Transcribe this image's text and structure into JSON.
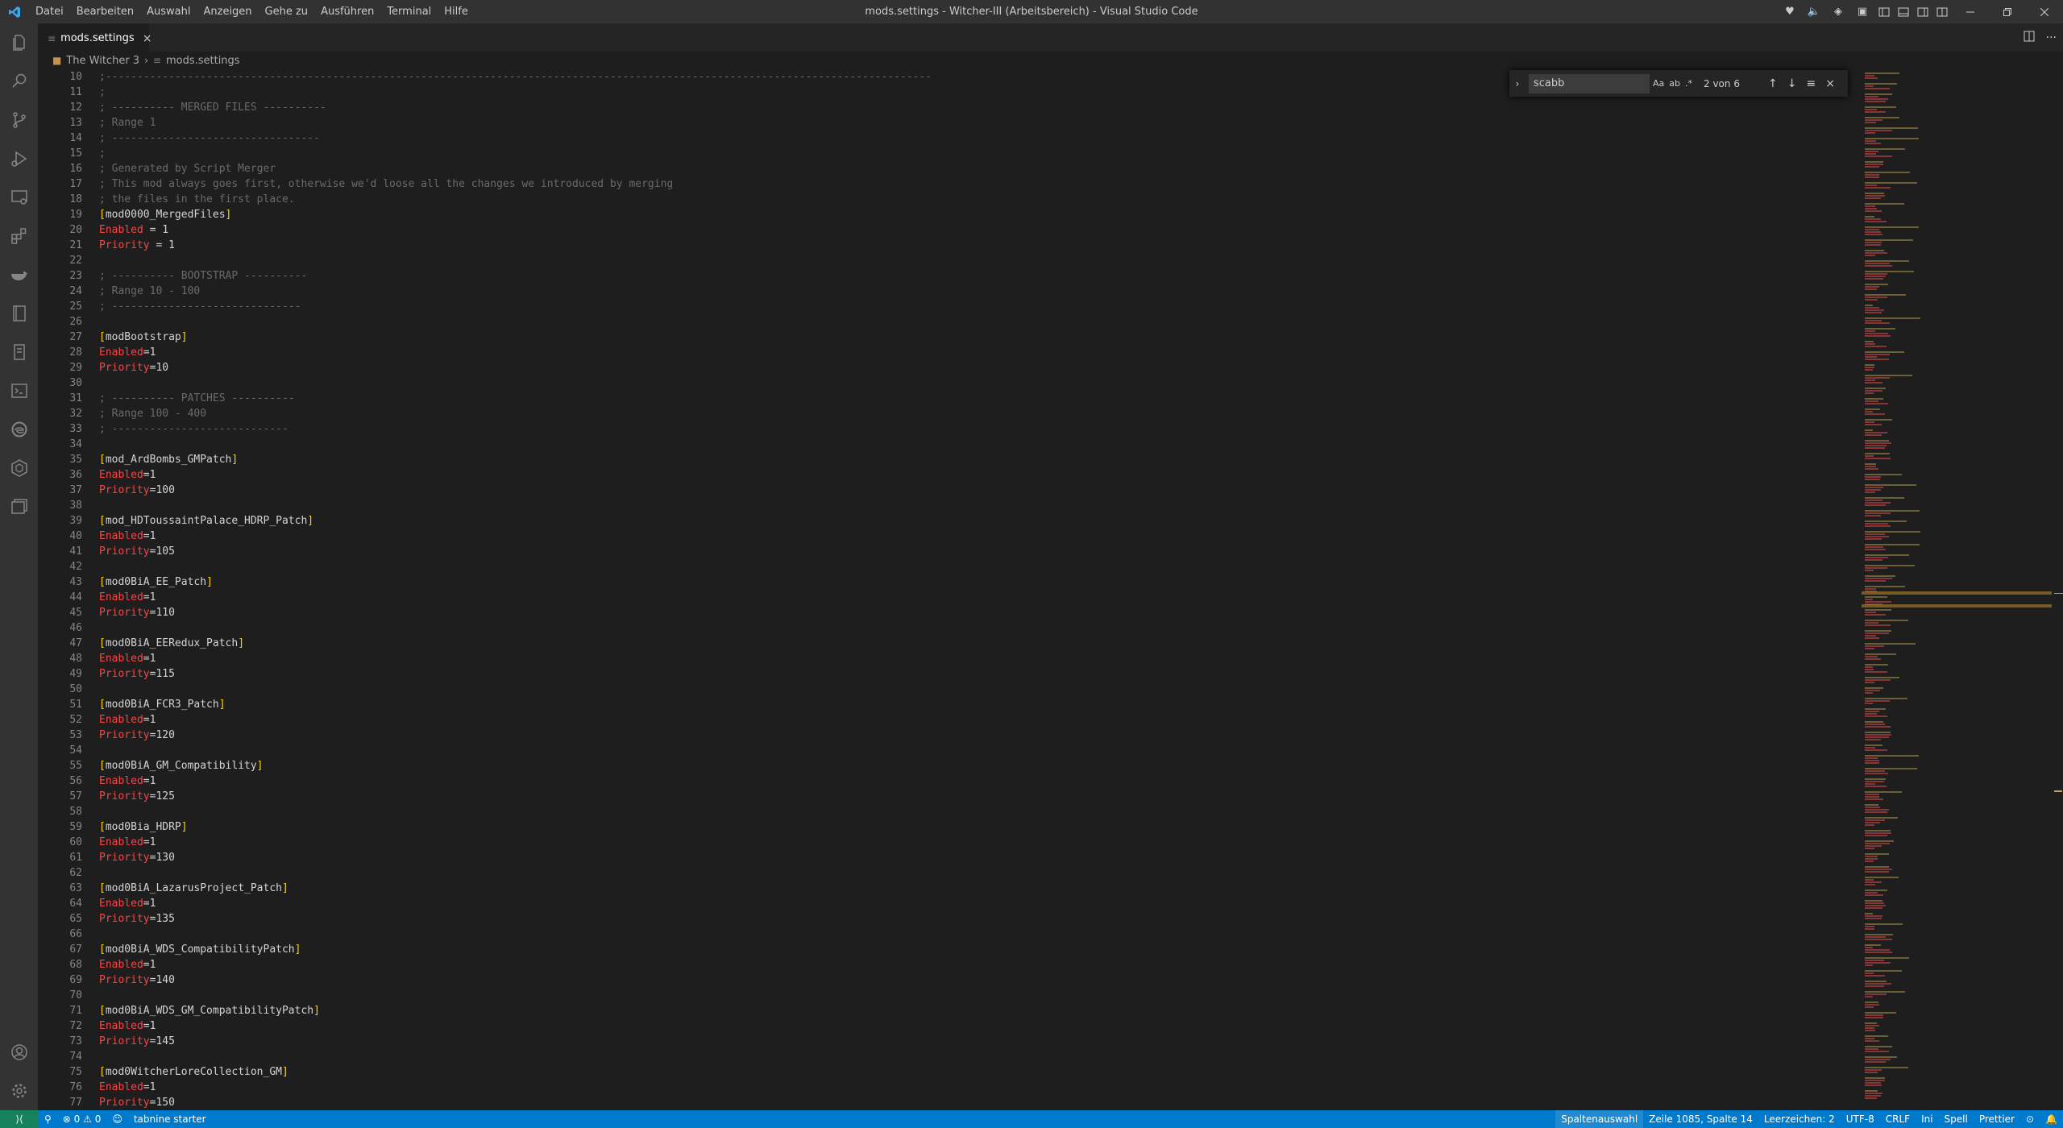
{
  "titlebar": {
    "menu": [
      "Datei",
      "Bearbeiten",
      "Auswahl",
      "Anzeigen",
      "Gehe zu",
      "Ausführen",
      "Terminal",
      "Hilfe"
    ],
    "window_title": "mods.settings - Witcher-III (Arbeitsbereich) - Visual Studio Code"
  },
  "tab": {
    "label": "mods.settings",
    "close": "×"
  },
  "breadcrumb": {
    "folder": "The Witcher 3",
    "file": "mods.settings"
  },
  "find": {
    "query": "scabb",
    "count": "2 von 6",
    "opts": [
      "Aa",
      "ab",
      ".*"
    ]
  },
  "editor": {
    "lines": [
      {
        "n": "10",
        "t": "c",
        "v": ";-----------------------------------------------------------------------------------------------------------------------------------"
      },
      {
        "n": "11",
        "t": "c",
        "v": ";"
      },
      {
        "n": "12",
        "t": "c",
        "v": "; ---------- MERGED FILES ----------"
      },
      {
        "n": "13",
        "t": "c",
        "v": "; Range 1"
      },
      {
        "n": "14",
        "t": "c",
        "v": "; ---------------------------------"
      },
      {
        "n": "15",
        "t": "c",
        "v": ";"
      },
      {
        "n": "16",
        "t": "c",
        "v": "; Generated by Script Merger"
      },
      {
        "n": "17",
        "t": "c",
        "v": "; This mod always goes first, otherwise we'd loose all the changes we introduced by merging"
      },
      {
        "n": "18",
        "t": "c",
        "v": "; the files in the first place."
      },
      {
        "n": "19",
        "t": "s",
        "v": "mod0000_MergedFiles"
      },
      {
        "n": "20",
        "t": "k",
        "k": "Enabled",
        "e": " = ",
        "v": "1"
      },
      {
        "n": "21",
        "t": "k",
        "k": "Priority",
        "e": " = ",
        "v": "1"
      },
      {
        "n": "22",
        "t": "b",
        "v": ""
      },
      {
        "n": "23",
        "t": "c",
        "v": "; ---------- BOOTSTRAP ----------"
      },
      {
        "n": "24",
        "t": "c",
        "v": "; Range 10 - 100"
      },
      {
        "n": "25",
        "t": "c",
        "v": "; ------------------------------"
      },
      {
        "n": "26",
        "t": "b",
        "v": ""
      },
      {
        "n": "27",
        "t": "s",
        "v": "modBootstrap"
      },
      {
        "n": "28",
        "t": "k",
        "k": "Enabled",
        "e": "=",
        "v": "1"
      },
      {
        "n": "29",
        "t": "k",
        "k": "Priority",
        "e": "=",
        "v": "10"
      },
      {
        "n": "30",
        "t": "b",
        "v": ""
      },
      {
        "n": "31",
        "t": "c",
        "v": "; ---------- PATCHES ----------"
      },
      {
        "n": "32",
        "t": "c",
        "v": "; Range 100 - 400"
      },
      {
        "n": "33",
        "t": "c",
        "v": "; ----------------------------"
      },
      {
        "n": "34",
        "t": "b",
        "v": ""
      },
      {
        "n": "35",
        "t": "s",
        "v": "mod_ArdBombs_GMPatch"
      },
      {
        "n": "36",
        "t": "k",
        "k": "Enabled",
        "e": "=",
        "v": "1"
      },
      {
        "n": "37",
        "t": "k",
        "k": "Priority",
        "e": "=",
        "v": "100"
      },
      {
        "n": "38",
        "t": "b",
        "v": ""
      },
      {
        "n": "39",
        "t": "s",
        "v": "mod_HDToussaintPalace_HDRP_Patch"
      },
      {
        "n": "40",
        "t": "k",
        "k": "Enabled",
        "e": "=",
        "v": "1"
      },
      {
        "n": "41",
        "t": "k",
        "k": "Priority",
        "e": "=",
        "v": "105"
      },
      {
        "n": "42",
        "t": "b",
        "v": ""
      },
      {
        "n": "43",
        "t": "s",
        "v": "mod0BiA_EE_Patch"
      },
      {
        "n": "44",
        "t": "k",
        "k": "Enabled",
        "e": "=",
        "v": "1"
      },
      {
        "n": "45",
        "t": "k",
        "k": "Priority",
        "e": "=",
        "v": "110"
      },
      {
        "n": "46",
        "t": "b",
        "v": ""
      },
      {
        "n": "47",
        "t": "s",
        "v": "mod0BiA_EERedux_Patch"
      },
      {
        "n": "48",
        "t": "k",
        "k": "Enabled",
        "e": "=",
        "v": "1"
      },
      {
        "n": "49",
        "t": "k",
        "k": "Priority",
        "e": "=",
        "v": "115"
      },
      {
        "n": "50",
        "t": "b",
        "v": ""
      },
      {
        "n": "51",
        "t": "s",
        "v": "mod0BiA_FCR3_Patch"
      },
      {
        "n": "52",
        "t": "k",
        "k": "Enabled",
        "e": "=",
        "v": "1"
      },
      {
        "n": "53",
        "t": "k",
        "k": "Priority",
        "e": "=",
        "v": "120"
      },
      {
        "n": "54",
        "t": "b",
        "v": ""
      },
      {
        "n": "55",
        "t": "s",
        "v": "mod0BiA_GM_Compatibility"
      },
      {
        "n": "56",
        "t": "k",
        "k": "Enabled",
        "e": "=",
        "v": "1"
      },
      {
        "n": "57",
        "t": "k",
        "k": "Priority",
        "e": "=",
        "v": "125"
      },
      {
        "n": "58",
        "t": "b",
        "v": ""
      },
      {
        "n": "59",
        "t": "s",
        "v": "mod0Bia_HDRP"
      },
      {
        "n": "60",
        "t": "k",
        "k": "Enabled",
        "e": "=",
        "v": "1"
      },
      {
        "n": "61",
        "t": "k",
        "k": "Priority",
        "e": "=",
        "v": "130"
      },
      {
        "n": "62",
        "t": "b",
        "v": ""
      },
      {
        "n": "63",
        "t": "s",
        "v": "mod0BiA_LazarusProject_Patch"
      },
      {
        "n": "64",
        "t": "k",
        "k": "Enabled",
        "e": "=",
        "v": "1"
      },
      {
        "n": "65",
        "t": "k",
        "k": "Priority",
        "e": "=",
        "v": "135"
      },
      {
        "n": "66",
        "t": "b",
        "v": ""
      },
      {
        "n": "67",
        "t": "s",
        "v": "mod0BiA_WDS_CompatibilityPatch"
      },
      {
        "n": "68",
        "t": "k",
        "k": "Enabled",
        "e": "=",
        "v": "1"
      },
      {
        "n": "69",
        "t": "k",
        "k": "Priority",
        "e": "=",
        "v": "140"
      },
      {
        "n": "70",
        "t": "b",
        "v": ""
      },
      {
        "n": "71",
        "t": "s",
        "v": "mod0BiA_WDS_GM_CompatibilityPatch"
      },
      {
        "n": "72",
        "t": "k",
        "k": "Enabled",
        "e": "=",
        "v": "1"
      },
      {
        "n": "73",
        "t": "k",
        "k": "Priority",
        "e": "=",
        "v": "145"
      },
      {
        "n": "74",
        "t": "b",
        "v": ""
      },
      {
        "n": "75",
        "t": "s",
        "v": "mod0WitcherLoreCollection_GM"
      },
      {
        "n": "76",
        "t": "k",
        "k": "Enabled",
        "e": "=",
        "v": "1"
      },
      {
        "n": "77",
        "t": "k",
        "k": "Priority",
        "e": "=",
        "v": "150"
      }
    ]
  },
  "statusbar": {
    "problems": "⊗ 0 ⚠ 0",
    "tabnine": "tabnine starter",
    "column_mode": "Spaltenauswahl",
    "position": "Zeile 1085, Spalte 14",
    "spaces": "Leerzeichen: 2",
    "encoding": "UTF-8",
    "eol": "CRLF",
    "language": "Ini",
    "spell": "Spell",
    "prettier": "Prettier"
  },
  "colors": {
    "accent": "#007acc",
    "key": "#f44747",
    "bracket": "#ffd700",
    "comment": "#6a6a6a"
  }
}
